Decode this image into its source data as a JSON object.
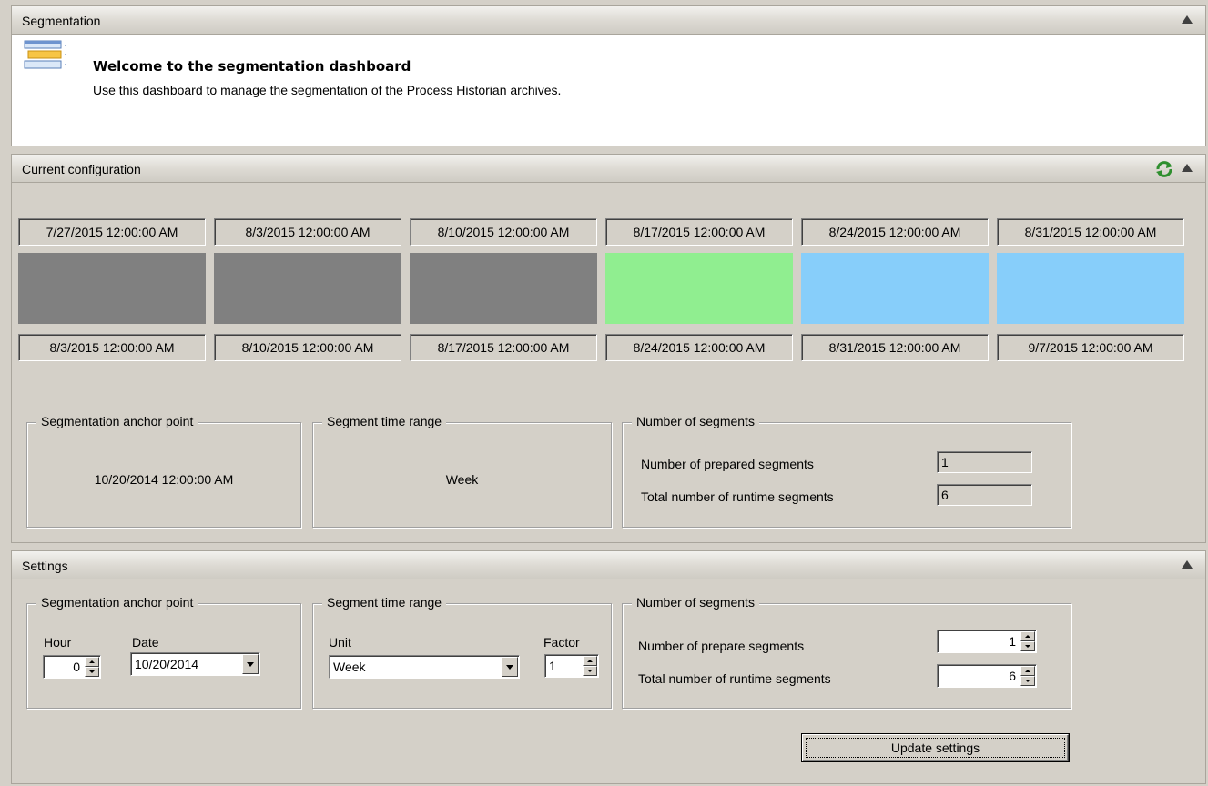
{
  "welcome_panel": {
    "title": "Segmentation",
    "heading": "Welcome to the segmentation dashboard",
    "description": "Use this dashboard to manage the segmentation of the Process Historian archives."
  },
  "config_panel": {
    "title": "Current configuration",
    "segments": [
      {
        "start": "7/27/2015 12:00:00 AM",
        "end": "8/3/2015 12:00:00 AM",
        "color": "#808080"
      },
      {
        "start": "8/3/2015 12:00:00 AM",
        "end": "8/10/2015 12:00:00 AM",
        "color": "#808080"
      },
      {
        "start": "8/10/2015 12:00:00 AM",
        "end": "8/17/2015 12:00:00 AM",
        "color": "#808080"
      },
      {
        "start": "8/17/2015 12:00:00 AM",
        "end": "8/24/2015 12:00:00 AM",
        "color": "#90ee90"
      },
      {
        "start": "8/24/2015 12:00:00 AM",
        "end": "8/31/2015 12:00:00 AM",
        "color": "#87cefa"
      },
      {
        "start": "8/31/2015 12:00:00 AM",
        "end": "9/7/2015 12:00:00 AM",
        "color": "#87cefa"
      }
    ],
    "anchor_group": {
      "legend": "Segmentation anchor point",
      "value": "10/20/2014 12:00:00 AM"
    },
    "range_group": {
      "legend": "Segment time range",
      "value": "Week"
    },
    "count_group": {
      "legend": "Number of segments",
      "prepared_label": "Number of prepared segments",
      "prepared_value": "1",
      "runtime_label": "Total number of runtime segments",
      "runtime_value": "6"
    }
  },
  "settings_panel": {
    "title": "Settings",
    "anchor_group": {
      "legend": "Segmentation anchor point",
      "hour_label": "Hour",
      "hour_value": "0",
      "date_label": "Date",
      "date_value": "10/20/2014"
    },
    "range_group": {
      "legend": "Segment time range",
      "unit_label": "Unit",
      "unit_value": "Week",
      "factor_label": "Factor",
      "factor_value": "1"
    },
    "count_group": {
      "legend": "Number of segments",
      "prepare_label": "Number of prepare segments",
      "prepare_value": "1",
      "runtime_label": "Total number of runtime segments",
      "runtime_value": "6"
    },
    "update_button": "Update settings"
  }
}
